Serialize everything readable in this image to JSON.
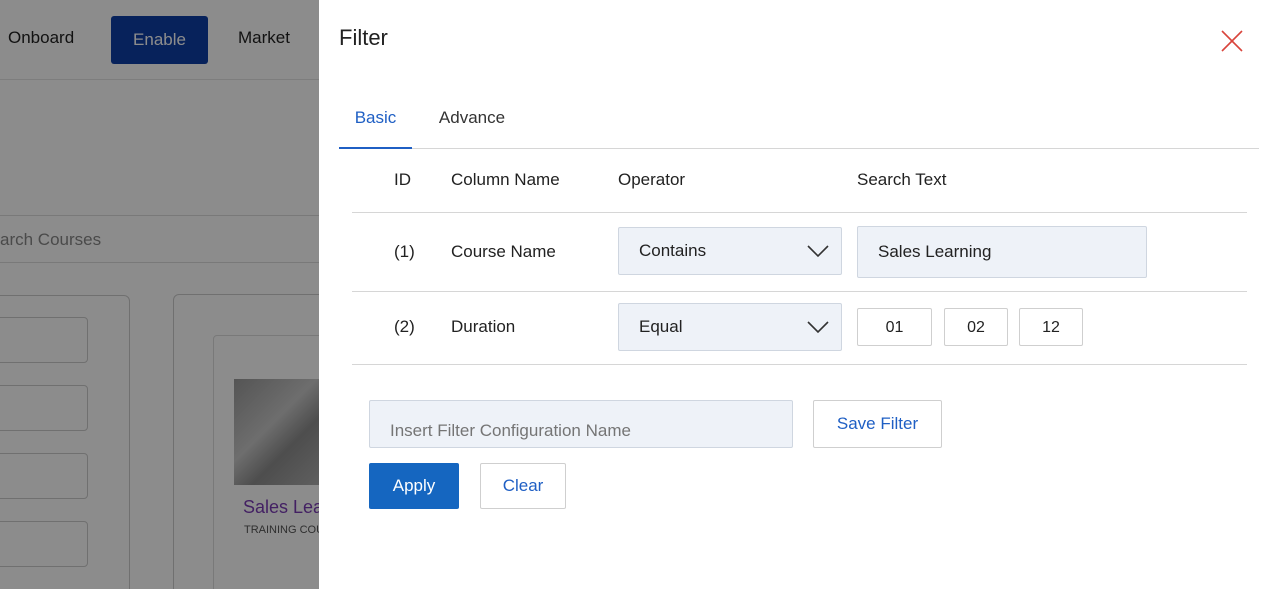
{
  "background": {
    "nav": {
      "onboard": "Onboard",
      "enable": "Enable",
      "market": "Market"
    },
    "search_placeholder": "arch Courses",
    "card": {
      "title": "Sales Lea",
      "subtitle": "TRAINING COU"
    }
  },
  "filter": {
    "title": "Filter",
    "close_icon": "close-icon",
    "tabs": [
      {
        "label": "Basic",
        "active": true
      },
      {
        "label": "Advance",
        "active": false
      }
    ],
    "columns": {
      "id": "ID",
      "column_name": "Column Name",
      "operator": "Operator",
      "search_text": "Search Text"
    },
    "rows": [
      {
        "id": "(1)",
        "column_name": "Course Name",
        "operator": "Contains",
        "search_text": "Sales Learning"
      },
      {
        "id": "(2)",
        "column_name": "Duration",
        "operator": "Equal",
        "duration": [
          "01",
          "02",
          "12"
        ]
      }
    ],
    "config_placeholder": "Insert Filter Configuration Name",
    "save_filter_label": "Save Filter",
    "apply_label": "Apply",
    "clear_label": "Clear"
  },
  "colors": {
    "accent": "#1f5fc4",
    "apply_bg": "#1566c0",
    "nav_active": "#0d3fa6",
    "close": "#d9443b",
    "input_bg": "#eef2f8"
  }
}
